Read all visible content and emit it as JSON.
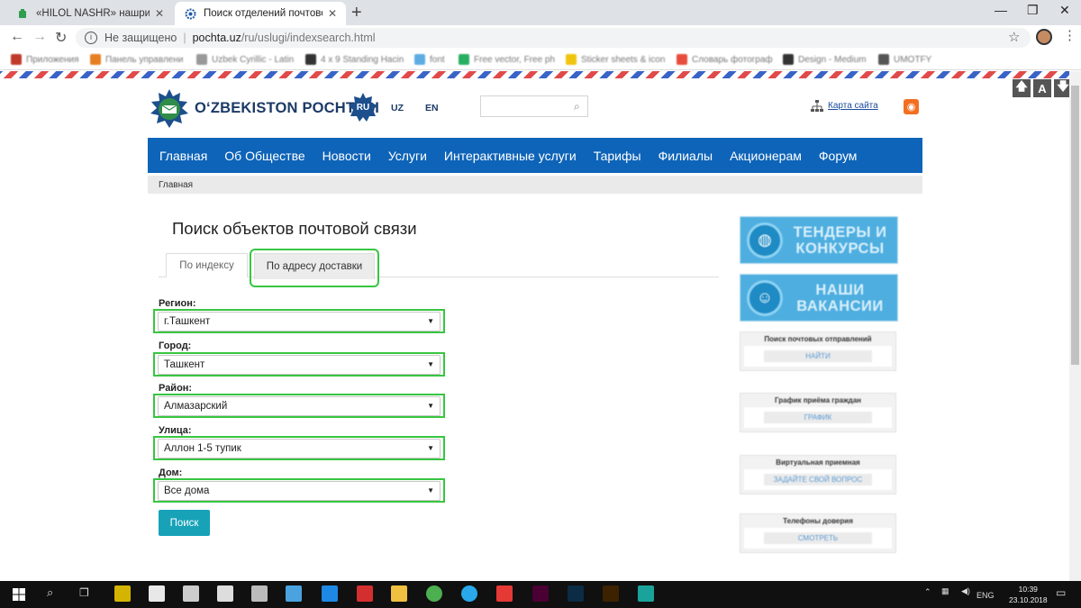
{
  "browser": {
    "tabs": [
      {
        "title": "«HILOL NASHR» нашриёт-матба",
        "close": "✕"
      },
      {
        "title": "Поиск отделений почтовой свя",
        "close": "✕"
      }
    ],
    "new_tab": "+",
    "window_controls": {
      "minimize": "—",
      "maximize": "❐",
      "close": "✕"
    },
    "address": {
      "security_text": "Не защищено",
      "separator": "|",
      "host": "pochta.uz",
      "path": "/ru/uslugi/indexsearch.html"
    },
    "bookmarks": [
      {
        "label": "Приложения",
        "color": "#c0392b"
      },
      {
        "label": "Панель управлени",
        "color": "#e67e22"
      },
      {
        "label": "Uzbek Cyrillic - Latin",
        "color": "#999999"
      },
      {
        "label": "4 x 9 Standing Hacin",
        "color": "#333333"
      },
      {
        "label": "font",
        "color": "#5dade2"
      },
      {
        "label": "Free vector, Free ph",
        "color": "#27ae60"
      },
      {
        "label": "Sticker sheets & icon",
        "color": "#f1c40f"
      },
      {
        "label": "Словарь фотограф",
        "color": "#e74c3c"
      },
      {
        "label": "Design - Medium",
        "color": "#333333"
      },
      {
        "label": "UMOTFY",
        "color": "#555555"
      }
    ]
  },
  "header": {
    "logo_text": "O‘ZBEKISTON POCHTASI",
    "languages": [
      "RU",
      "UZ",
      "EN"
    ],
    "search_placeholder": "",
    "sitemap_label": "Карта сайта",
    "accessibility": [
      "🡅",
      "A",
      "🡇"
    ]
  },
  "nav": {
    "items": [
      "Главная",
      "Об Обществе",
      "Новости",
      "Услуги",
      "Интерактивные услуги",
      "Тарифы",
      "Филиалы",
      "Акционерам",
      "Форум"
    ]
  },
  "breadcrumb": "Главная",
  "main": {
    "title": "Поиск объектов почтовой связи",
    "tabs": [
      "По индексу",
      "По адресу доставки"
    ],
    "fields": [
      {
        "label": "Регион:",
        "value": "г.Ташкент"
      },
      {
        "label": "Город:",
        "value": "Ташкент"
      },
      {
        "label": "Район:",
        "value": "Алмазарский"
      },
      {
        "label": "Улица:",
        "value": "Аллон 1-5 тупик"
      },
      {
        "label": "Дом:",
        "value": "Все дома"
      }
    ],
    "search_button": "Поиск"
  },
  "sidebar": {
    "banners": [
      "ТЕНДЕРЫ И КОНКУРСЫ",
      "НАШИ ВАКАНСИИ"
    ],
    "blocks": [
      {
        "title": "Поиск почтовых отправлений",
        "link": "НАЙТИ"
      },
      {
        "title": "График приёма граждан",
        "link": "ГРАФИК"
      },
      {
        "title": "Виртуальная приемная",
        "link": "ЗАДАЙТЕ СВОЙ ВОПРОС"
      },
      {
        "title": "Телефоны доверия",
        "link": "СМОТРЕТЬ"
      }
    ]
  },
  "taskbar": {
    "language": "ENG",
    "time": "10:39",
    "date": "23.10.2018"
  }
}
